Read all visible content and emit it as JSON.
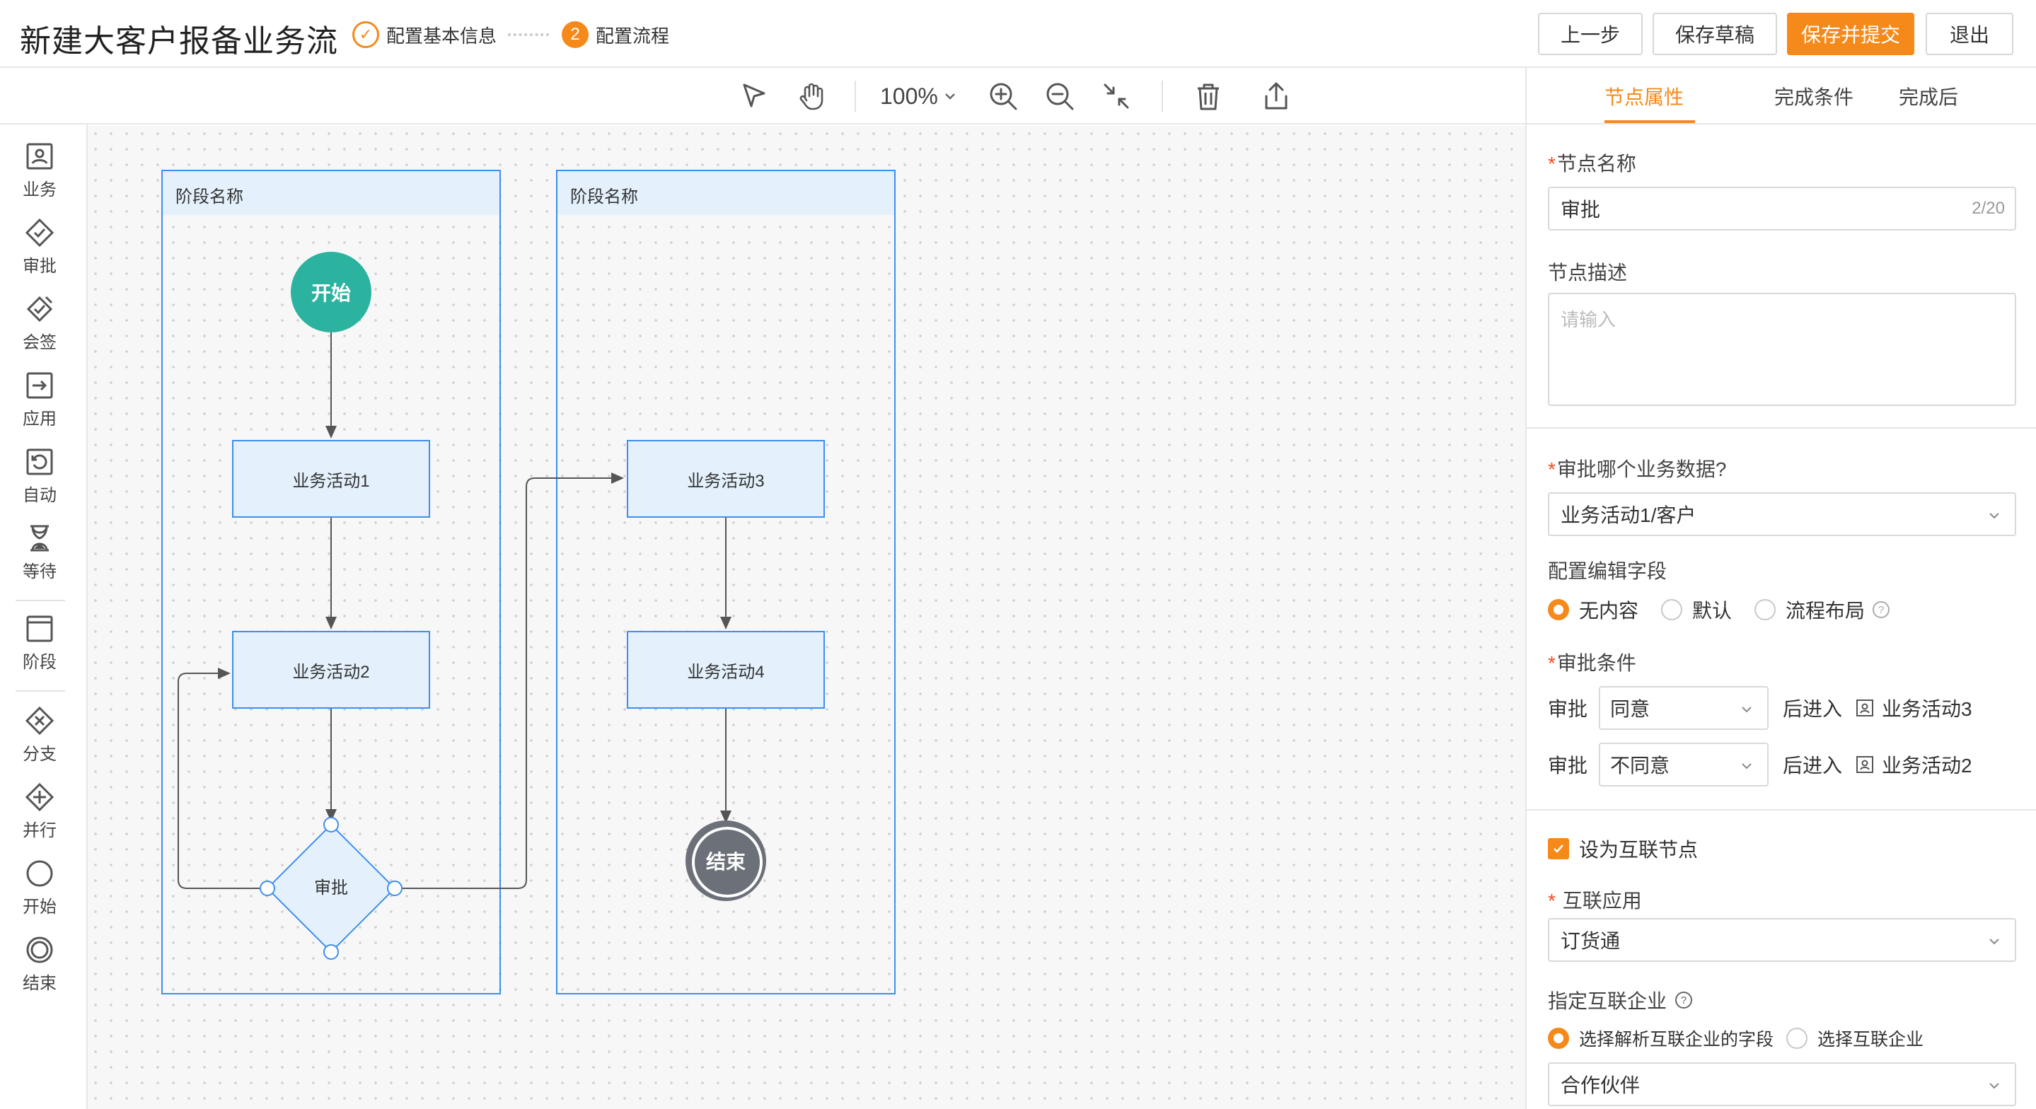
{
  "header": {
    "title": "新建大客户报备业务流",
    "steps": [
      {
        "label": "配置基本信息",
        "state": "done"
      },
      {
        "label": "配置流程",
        "number": "2",
        "state": "current"
      }
    ],
    "buttons": {
      "prev": "上一步",
      "save_draft": "保存草稿",
      "save_submit": "保存并提交",
      "exit": "退出"
    }
  },
  "toolbar": {
    "zoom": "100%",
    "icons": [
      "select-pointer-icon",
      "hand-pan-icon",
      "zoom-in-icon",
      "zoom-out-icon",
      "fit-view-icon",
      "delete-icon",
      "export-icon"
    ]
  },
  "palette": {
    "items": [
      {
        "label": "业务",
        "icon": "business-icon"
      },
      {
        "label": "审批",
        "icon": "approval-icon"
      },
      {
        "label": "会签",
        "icon": "countersign-icon"
      },
      {
        "label": "应用",
        "icon": "application-icon"
      },
      {
        "label": "自动",
        "icon": "auto-icon"
      },
      {
        "label": "等待",
        "icon": "wait-icon"
      },
      {
        "label": "阶段",
        "icon": "stage-icon"
      },
      {
        "label": "分支",
        "icon": "branch-icon"
      },
      {
        "label": "并行",
        "icon": "parallel-icon"
      },
      {
        "label": "开始",
        "icon": "start-icon"
      },
      {
        "label": "结束",
        "icon": "end-icon"
      }
    ]
  },
  "diagram": {
    "lanes": [
      {
        "title": "阶段名称"
      },
      {
        "title": "阶段名称"
      }
    ],
    "start": "开始",
    "end": "结束",
    "activities": [
      "业务活动1",
      "业务活动2",
      "业务活动3",
      "业务活动4"
    ],
    "decision": "审批",
    "colors": {
      "lane_border": "#3d8ef0",
      "node_fill": "#e4f1fc",
      "start": "#2bb3a0",
      "end": "#6b7079"
    }
  },
  "panel": {
    "tabs": [
      "节点属性",
      "完成条件",
      "完成后"
    ],
    "active_tab": "节点属性",
    "node_name_label": "节点名称",
    "node_name_value": "审批",
    "node_name_counter": "2/20",
    "node_desc_label": "节点描述",
    "node_desc_placeholder": "请输入",
    "approve_data_label": "审批哪个业务数据?",
    "approve_data_value": "业务活动1/客户",
    "edit_fields_label": "配置编辑字段",
    "edit_fields_options": [
      "无内容",
      "默认",
      "流程布局"
    ],
    "edit_fields_selected": "无内容",
    "conditions_label": "审批条件",
    "conditions": [
      {
        "prefix": "审批",
        "select": "同意",
        "middle": "后进入",
        "target": "业务活动3"
      },
      {
        "prefix": "审批",
        "select": "不同意",
        "middle": "后进入",
        "target": "业务活动2"
      }
    ],
    "interconnect_checkbox": "设为互联节点",
    "interconnect_checked": true,
    "interconnect_app_label": "互联应用",
    "interconnect_app_value": "订货通",
    "enterprise_label": "指定互联企业",
    "enterprise_options": [
      "选择解析互联企业的字段",
      "选择互联企业"
    ],
    "enterprise_selected": "选择解析互联企业的字段",
    "enterprise_field_value": "合作伙伴"
  },
  "accent": "#f5891a"
}
